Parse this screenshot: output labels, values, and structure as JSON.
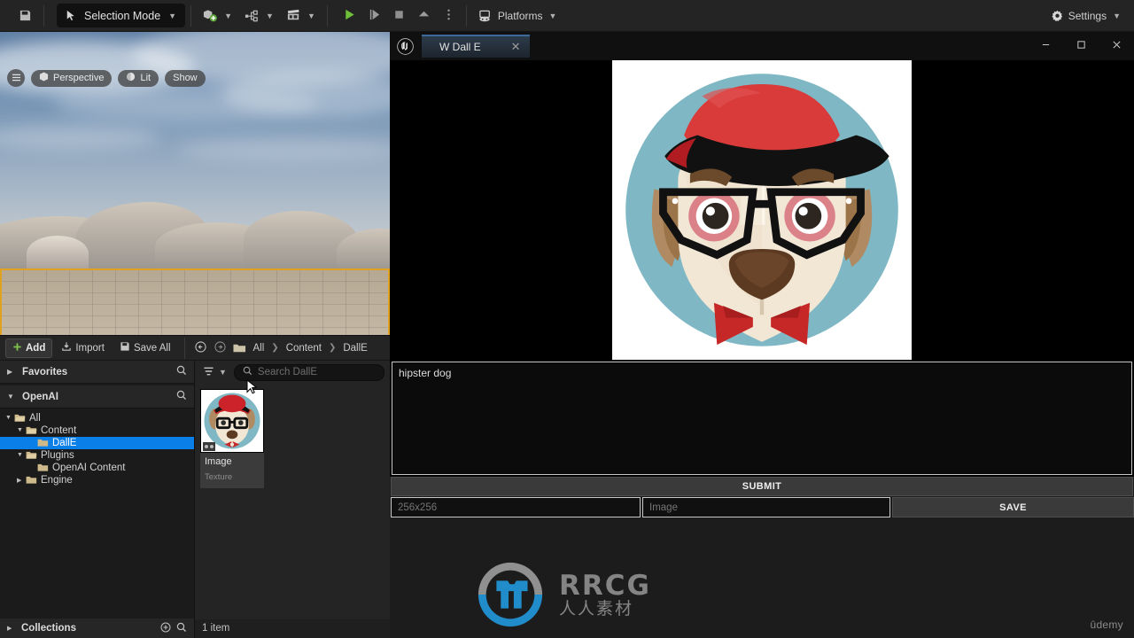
{
  "toolbar": {
    "save_icon": "save-icon",
    "mode": {
      "label": "Selection Mode",
      "icon": "cursor-select-icon"
    },
    "quick_add": {
      "icon": "add-actor-icon"
    },
    "blueprints": {
      "icon": "blueprint-node-icon"
    },
    "cinematics": {
      "icon": "clapperboard-icon"
    },
    "play": {
      "icon": "play-icon"
    },
    "skip": {
      "icon": "step-icon"
    },
    "stop": {
      "icon": "stop-icon"
    },
    "eject": {
      "icon": "eject-icon"
    },
    "more": {
      "icon": "kebab-menu-icon"
    },
    "platforms": {
      "label": "Platforms",
      "icon": "platforms-icon"
    },
    "settings": {
      "label": "Settings",
      "icon": "gear-icon"
    }
  },
  "viewport": {
    "menu_icon": "hamburger-icon",
    "perspective": {
      "label": "Perspective",
      "icon": "cube-icon"
    },
    "lighting": {
      "label": "Lit",
      "icon": "lighting-icon"
    },
    "show": {
      "label": "Show"
    }
  },
  "content_browser": {
    "add_label": "Add",
    "import_label": "Import",
    "save_all_label": "Save All",
    "back_icon": "arrow-back-icon",
    "forward_icon": "arrow-forward-icon",
    "folder_icon": "folder-icon",
    "breadcrumb": [
      "All",
      "Content",
      "DallE"
    ],
    "sources": {
      "favorites": {
        "label": "Favorites",
        "expanded": false
      },
      "openai": {
        "label": "OpenAI",
        "expanded": true
      },
      "tree": [
        {
          "label": "All",
          "depth": 0,
          "expanded": true,
          "selected": false,
          "has_children": true,
          "open_folder": true
        },
        {
          "label": "Content",
          "depth": 1,
          "expanded": true,
          "selected": false,
          "has_children": true,
          "open_folder": true
        },
        {
          "label": "DallE",
          "depth": 2,
          "expanded": false,
          "selected": true,
          "has_children": false,
          "open_folder": false
        },
        {
          "label": "Plugins",
          "depth": 1,
          "expanded": true,
          "selected": false,
          "has_children": true,
          "open_folder": true
        },
        {
          "label": "OpenAI Content",
          "depth": 2,
          "expanded": false,
          "selected": false,
          "has_children": false,
          "open_folder": false
        },
        {
          "label": "Engine",
          "depth": 1,
          "expanded": false,
          "selected": false,
          "has_children": true,
          "open_folder": false
        }
      ]
    },
    "filter_icon": "filter-icon",
    "search": {
      "placeholder": "Search DallE",
      "value": ""
    },
    "assets": [
      {
        "name": "Image",
        "type": "Texture",
        "badge": "texture-badge-icon"
      }
    ],
    "collections": {
      "label": "Collections",
      "add_icon": "plus-circle-icon",
      "search_icon": "search-icon"
    },
    "status": "1 item"
  },
  "dalle_window": {
    "logo_icon": "unreal-engine-icon",
    "tab": {
      "label": "W Dall E",
      "close_icon": "close-icon"
    },
    "minimize_icon": "minimize-icon",
    "maximize_icon": "maximize-icon",
    "close_icon": "close-icon",
    "prompt": {
      "value": "hipster dog",
      "placeholder": ""
    },
    "submit_label": "SUBMIT",
    "size_field": {
      "value": "256x256",
      "placeholder": "256x256"
    },
    "name_field": {
      "value": "Image",
      "placeholder": "Image"
    },
    "save_label": "SAVE",
    "image": {
      "alt": "hipster dog illustration",
      "bg_color": "#7fb8c4",
      "hat_color": "#cc2229",
      "hat_band_color": "#111111",
      "ear_color": "#b08a62",
      "face_color": "#f2e6d4",
      "nose_color": "#5c3a22",
      "glasses_color": "#111111",
      "bowtie_color": "#c62828"
    }
  },
  "watermarks": {
    "rrcg_main": "RRCG",
    "rrcg_sub": "人人素材",
    "udemy": "ûdemy"
  },
  "colors": {
    "accent_blue": "#0a7fe8",
    "selection_orange": "#e0a020",
    "play_green": "#6fbf3a",
    "panel_bg": "#242424"
  }
}
